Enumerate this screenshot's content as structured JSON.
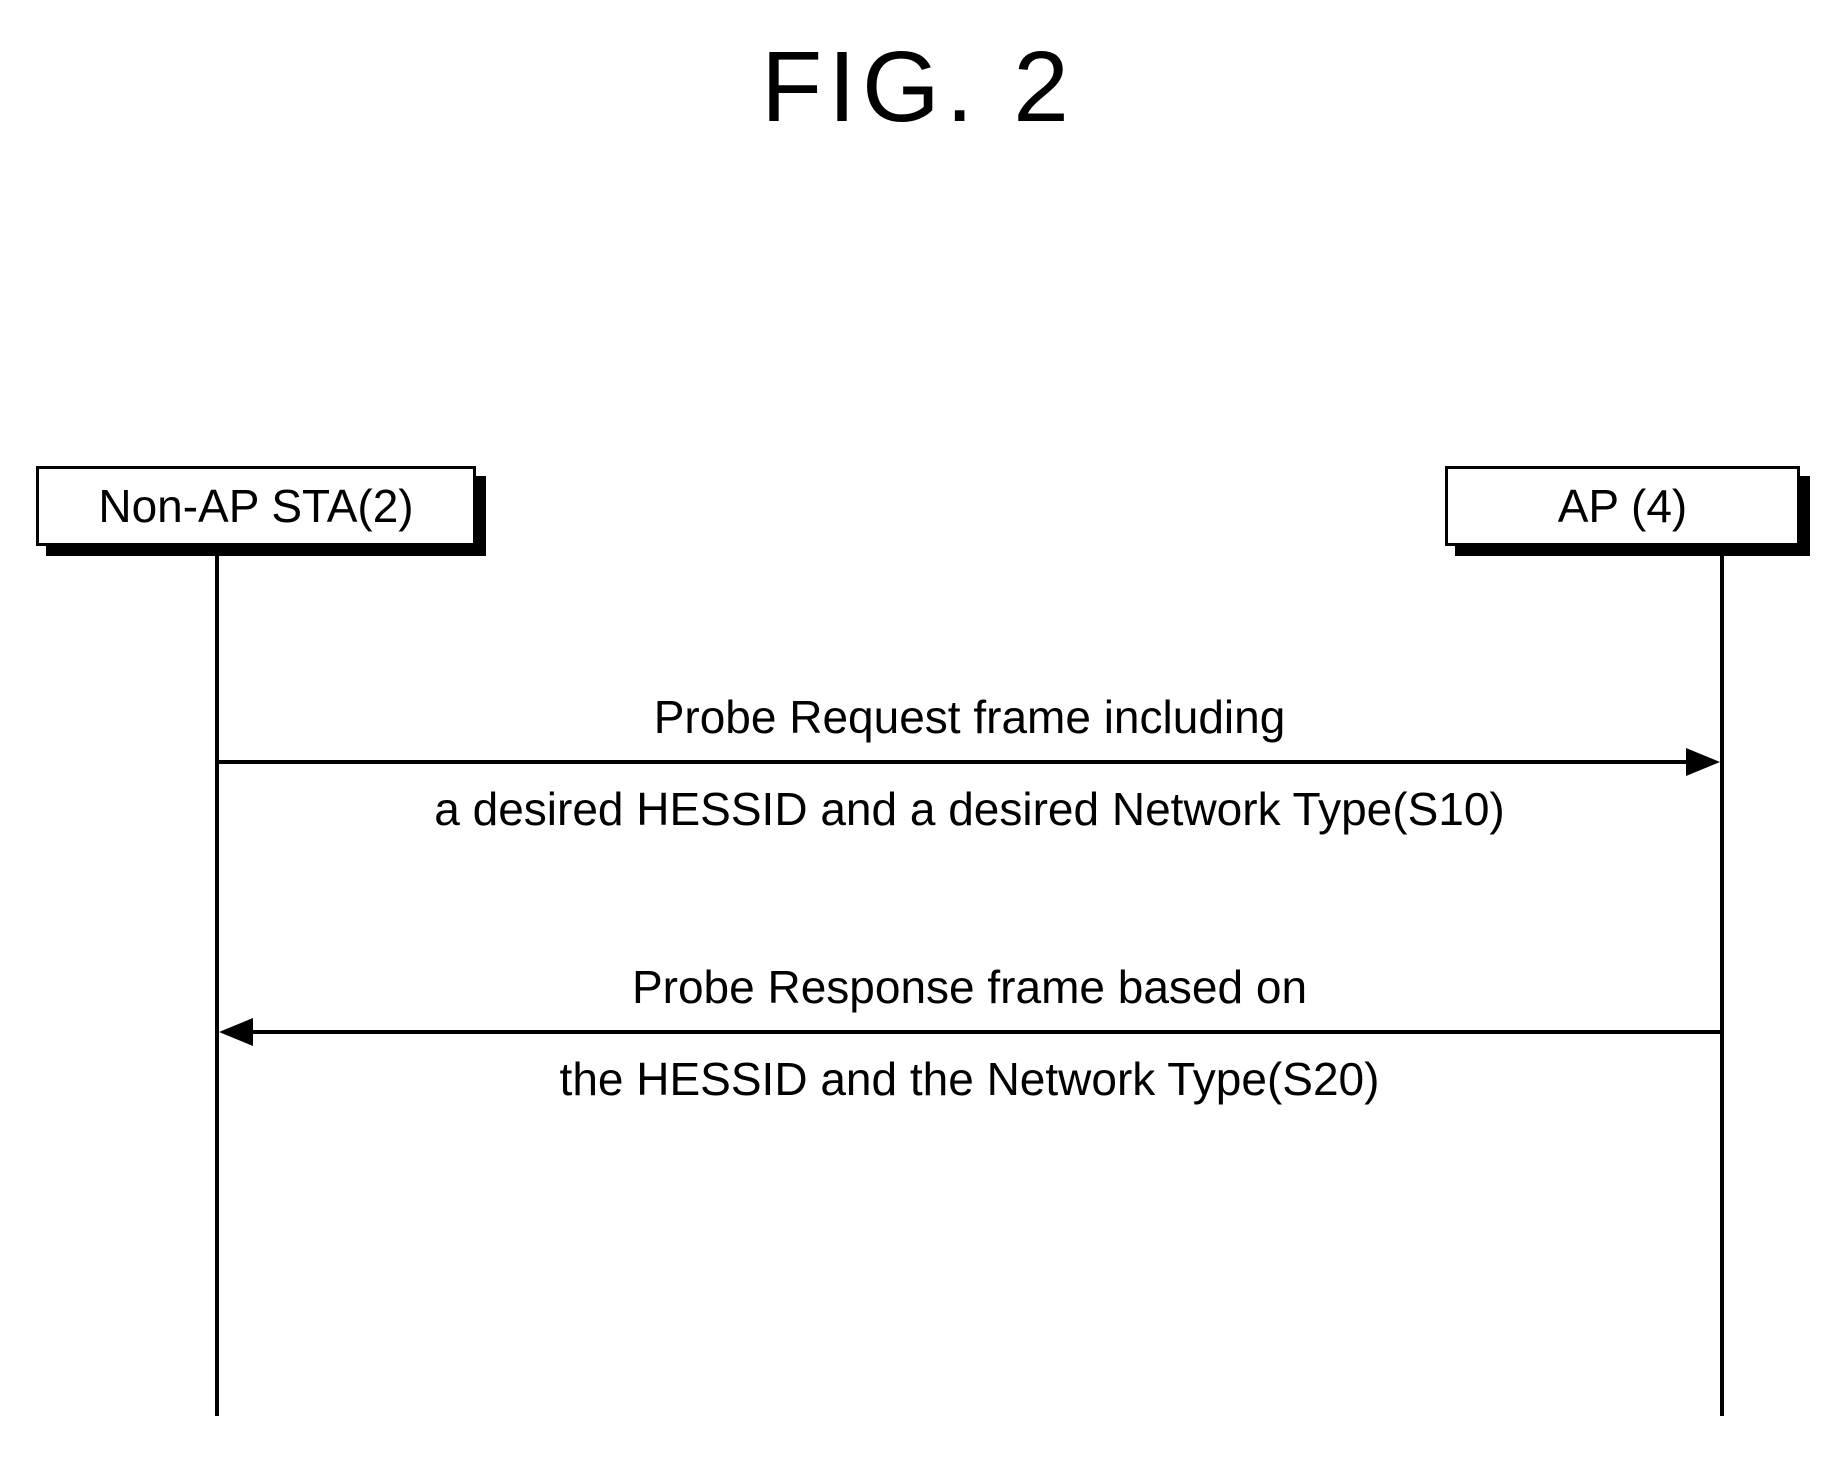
{
  "figure": {
    "title": "FIG. 2"
  },
  "actors": {
    "left": "Non-AP STA(2)",
    "right": "AP (4)"
  },
  "messages": {
    "m1_line1": "Probe Request frame including",
    "m1_line2": "a desired HESSID and a desired Network Type(S10)",
    "m2_line1": "Probe Response frame based on",
    "m2_line2": "the HESSID and the Network Type(S20)"
  },
  "chart_data": {
    "type": "sequence-diagram",
    "title": "FIG. 2",
    "participants": [
      {
        "id": "non-ap-sta",
        "label": "Non-AP STA(2)"
      },
      {
        "id": "ap",
        "label": "AP (4)"
      }
    ],
    "messages": [
      {
        "from": "non-ap-sta",
        "to": "ap",
        "step": "S10",
        "label": "Probe Request frame including a desired HESSID and a desired Network Type"
      },
      {
        "from": "ap",
        "to": "non-ap-sta",
        "step": "S20",
        "label": "Probe Response frame based on the HESSID and the Network Type"
      }
    ]
  }
}
